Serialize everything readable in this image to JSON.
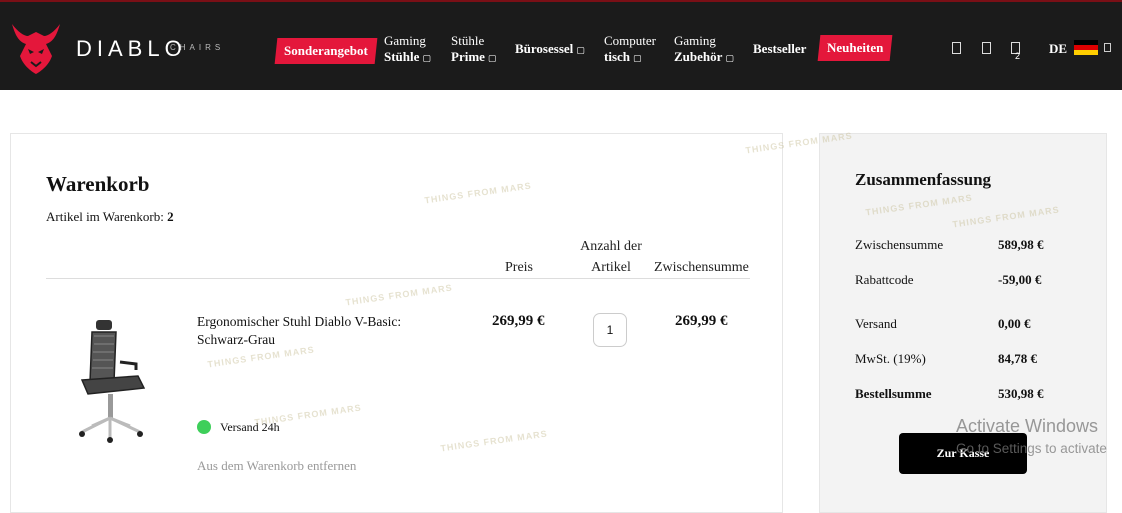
{
  "header": {
    "brand": "DIABLO",
    "brand_sub": "CHAIRS",
    "menu": [
      {
        "label_top": "Sonderangebot",
        "label_bottom": "",
        "promo": true
      },
      {
        "label_top": "Gaming",
        "label_bottom": "Stühle"
      },
      {
        "label_top": "Stühle",
        "label_bottom": "Prime"
      },
      {
        "label_top": "Bürosessel",
        "label_bottom": ""
      },
      {
        "label_top": "Computer",
        "label_bottom": "tisch"
      },
      {
        "label_top": "Gaming",
        "label_bottom": "Zubehör"
      },
      {
        "label_top": "Bestseller",
        "label_bottom": ""
      },
      {
        "label_top": "Neuheiten",
        "label_bottom": "",
        "promo": true
      }
    ],
    "cart_count": "2",
    "language": "DE",
    "colors": {
      "nav_bg": "#1b1b1b",
      "promo": "#e4173b"
    }
  },
  "cart": {
    "title": "Warenkorb",
    "count_label": "Artikel im Warenkorb:",
    "count_value": "2",
    "columns": {
      "price": "Preis",
      "qty_line1": "Anzahl der",
      "qty_line2": "Artikel",
      "subtotal": "Zwischensumme"
    },
    "item": {
      "name": "Ergonomischer Stuhl Diablo V-Basic: Schwarz-Grau",
      "price": "269,99 €",
      "quantity": "1",
      "subtotal": "269,99 €",
      "shipping": "Versand 24h",
      "remove": "Aus dem Warenkorb entfernen"
    }
  },
  "summary": {
    "title": "Zusammenfassung",
    "rows": [
      {
        "label": "Zwischensumme",
        "value": "589,98 €"
      },
      {
        "label": "Rabattcode",
        "value": "-59,00 €"
      },
      {
        "label": "Versand",
        "value": "0,00 €"
      },
      {
        "label": "MwSt. (19%)",
        "value": "84,78 €"
      },
      {
        "label": "Bestellsumme",
        "value": "530,98 €"
      }
    ],
    "checkout": "Zur Kasse"
  },
  "watermark": "THINGS FROM MARS",
  "windows": {
    "line1": "Activate Windows",
    "line2": "Go to Settings to activate"
  }
}
